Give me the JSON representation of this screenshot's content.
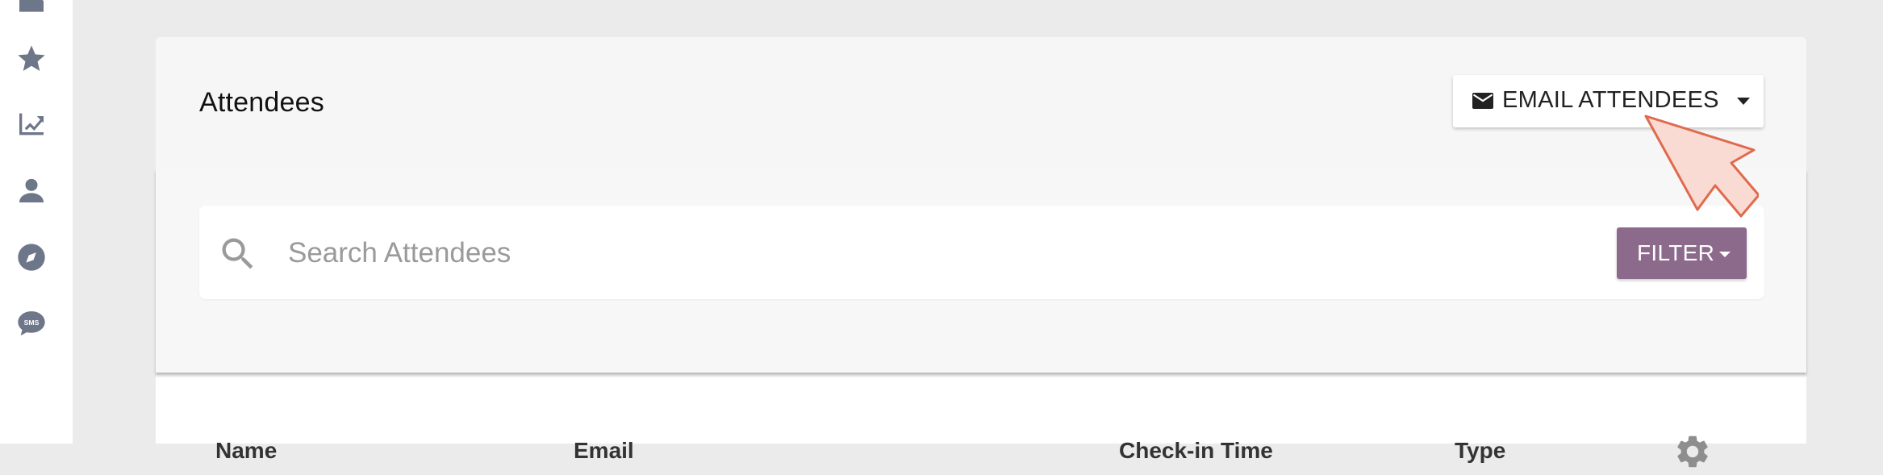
{
  "sidebar": {
    "items": [
      {
        "icon": "edit-icon"
      },
      {
        "icon": "star-icon"
      },
      {
        "icon": "trending-up-icon"
      },
      {
        "icon": "person-icon"
      },
      {
        "icon": "compass-icon"
      },
      {
        "icon": "sms-icon",
        "badge_text": "SMS"
      }
    ]
  },
  "header": {
    "title": "Attendees",
    "email_button_label": "EMAIL ATTENDEES"
  },
  "search": {
    "placeholder": "Search Attendees",
    "value": "",
    "filter_label": "FILTER"
  },
  "table": {
    "columns": [
      "Name",
      "Email",
      "Check-in Time",
      "Type"
    ]
  },
  "colors": {
    "filter_button": "#8c6a8c",
    "sidebar_icon": "#6e7689",
    "cursor_fill": "#f9dbd3",
    "cursor_stroke": "#e06a4e"
  }
}
